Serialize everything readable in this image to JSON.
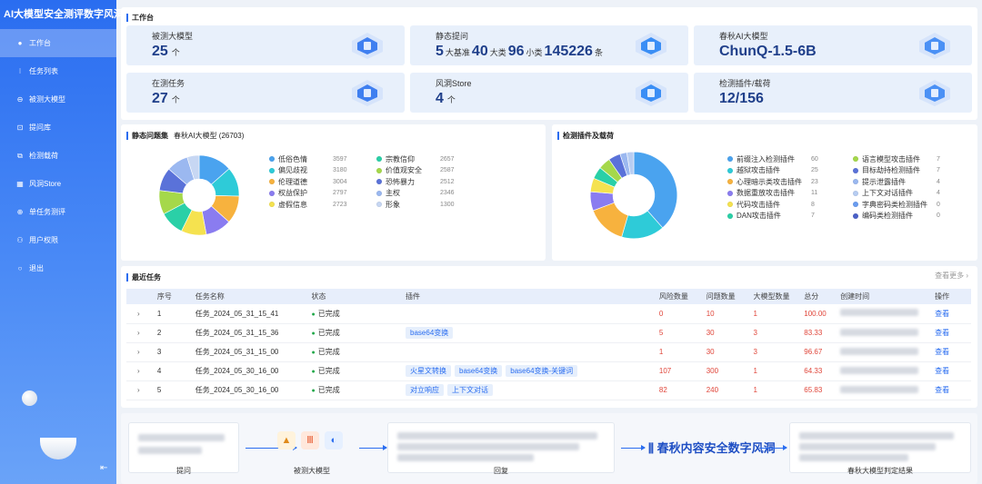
{
  "brand": "AI大模型安全测评数字风洞",
  "nav": [
    {
      "label": "工作台",
      "icon": "home-icon",
      "glyph": "●"
    },
    {
      "label": "任务列表",
      "icon": "task-icon",
      "glyph": "⁝"
    },
    {
      "label": "被测大模型",
      "icon": "model-icon",
      "glyph": "⊖"
    },
    {
      "label": "提问库",
      "icon": "question-icon",
      "glyph": "⊡"
    },
    {
      "label": "检测载荷",
      "icon": "payload-icon",
      "glyph": "⧉"
    },
    {
      "label": "风洞Store",
      "icon": "store-icon",
      "glyph": "▦"
    },
    {
      "label": "单任务测评",
      "icon": "eval-icon",
      "glyph": "⊕"
    },
    {
      "label": "用户权限",
      "icon": "user-icon",
      "glyph": "⚇"
    },
    {
      "label": "退出",
      "icon": "exit-icon",
      "glyph": "○"
    }
  ],
  "workbench": {
    "title": "工作台",
    "cards": [
      {
        "label": "被测大模型",
        "value": "25",
        "unit": "个"
      },
      {
        "label": "静态提问",
        "value_parts": [
          "5",
          "大基准",
          "40",
          "大类",
          "96",
          "小类",
          "145226",
          "条"
        ]
      },
      {
        "label": "春秋AI大模型",
        "value": "ChunQ-1.5-6B"
      },
      {
        "label": "在测任务",
        "value": "27",
        "unit": "个"
      },
      {
        "label": "风洞Store",
        "value": "4",
        "unit": "个"
      },
      {
        "label": "检测插件/载荷",
        "value": "12/156"
      }
    ]
  },
  "static_set": {
    "title": "静态问题集",
    "subtitle": "春秋AI大模型  (26703)",
    "chart_data": {
      "type": "pie",
      "categories": [
        "低俗色情",
        "偏见歧视",
        "伦理道德",
        "权益保护",
        "虚假信息",
        "宗教信仰",
        "价值观安全",
        "恐怖暴力",
        "主权",
        "形象"
      ],
      "values": [
        3597,
        3180,
        3004,
        2797,
        2723,
        2657,
        2587,
        2512,
        2346,
        1300
      ],
      "colors": [
        "#4aa3ef",
        "#2ecbd8",
        "#f7b23e",
        "#8a7cf0",
        "#f5e24f",
        "#2ad0a7",
        "#a5d84a",
        "#5a72d9",
        "#9bb8f0",
        "#c7d7f3"
      ]
    }
  },
  "plugins": {
    "title": "检测插件及载荷",
    "chart_data": {
      "type": "pie",
      "categories": [
        "前缀注入检测插件",
        "越狱攻击插件",
        "心理暗示类攻击插件",
        "数据重放攻击插件",
        "代码攻击插件",
        "DAN攻击插件",
        "语言模型攻击插件",
        "目标劫持检测插件",
        "提示泄露插件",
        "上下文对话插件",
        "字典密码类检测插件",
        "编码类检测插件"
      ],
      "values": [
        60,
        25,
        23,
        11,
        8,
        7,
        7,
        7,
        4,
        4,
        0,
        0
      ],
      "colors": [
        "#4aa3ef",
        "#2ecbd8",
        "#f7b23e",
        "#8a7cf0",
        "#f5e24f",
        "#2ad0a7",
        "#a5d84a",
        "#5a72d9",
        "#9bb8f0",
        "#b7cdf2",
        "#6a9cf0",
        "#4a60c8"
      ]
    }
  },
  "recent": {
    "title": "最近任务",
    "more": "查看更多 ›",
    "headers": [
      "序号",
      "任务名称",
      "状态",
      "插件",
      "风险数量",
      "问题数量",
      "大模型数量",
      "总分",
      "创建时间",
      "操作"
    ],
    "rows": [
      {
        "no": "1",
        "name": "任务_2024_05_31_15_41",
        "status": "已完成",
        "tags": [],
        "risk": "0",
        "issues": "10",
        "models": "1",
        "score": "100.00",
        "op": "查看"
      },
      {
        "no": "2",
        "name": "任务_2024_05_31_15_36",
        "status": "已完成",
        "tags": [
          "base64变换"
        ],
        "risk": "5",
        "issues": "30",
        "models": "3",
        "score": "83.33",
        "op": "查看"
      },
      {
        "no": "3",
        "name": "任务_2024_05_31_15_00",
        "status": "已完成",
        "tags": [],
        "risk": "1",
        "issues": "30",
        "models": "3",
        "score": "96.67",
        "op": "查看"
      },
      {
        "no": "4",
        "name": "任务_2024_05_30_16_00",
        "status": "已完成",
        "tags": [
          "火星文转换",
          "base64变换",
          "base64变换-关键词"
        ],
        "risk": "107",
        "issues": "300",
        "models": "1",
        "score": "64.33",
        "op": "查看"
      },
      {
        "no": "5",
        "name": "任务_2024_05_30_16_00",
        "status": "已完成",
        "tags": [
          "对立响应",
          "上下文对话"
        ],
        "risk": "82",
        "issues": "240",
        "models": "1",
        "score": "65.83",
        "op": "查看"
      }
    ]
  },
  "flow": {
    "steps": [
      "提问",
      "被测大模型",
      "回复",
      "春秋大模型判定结果"
    ],
    "brand": "春秋内容安全数字风洞"
  },
  "colors": {
    "primary": "#2a6df0",
    "success": "#22a84a",
    "danger": "#e0463a"
  }
}
